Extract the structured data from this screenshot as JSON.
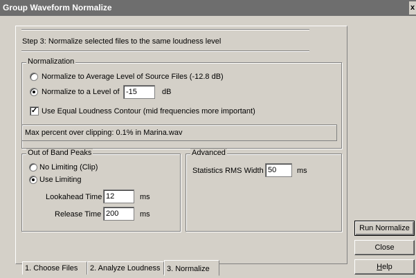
{
  "window": {
    "title": "Group Waveform Normalize",
    "close_glyph": "x"
  },
  "step_text": "Step 3:  Normalize selected files to the same loudness level",
  "normalization": {
    "legend": "Normalization",
    "option_average": "Normalize to Average Level of Source Files (-12.8 dB)",
    "option_level": "Normalize to a Level of",
    "level_value": "-15",
    "level_unit": "dB",
    "selected": "level",
    "equal_loudness_label": "Use Equal Loudness Contour (mid frequencies more important)",
    "equal_loudness_checked": true,
    "status": "Max percent over clipping: 0.1% in Marina.wav"
  },
  "out_of_band": {
    "legend": "Out of Band Peaks",
    "option_no_limiting": "No Limiting (Clip)",
    "option_use_limiting": "Use Limiting",
    "selected": "use_limiting",
    "lookahead_label": "Lookahead Time",
    "lookahead_value": "12",
    "lookahead_unit": "ms",
    "release_label": "Release Time",
    "release_value": "200",
    "release_unit": "ms"
  },
  "advanced": {
    "legend": "Advanced",
    "rms_label": "Statistics RMS Width",
    "rms_value": "50",
    "rms_unit": "ms"
  },
  "tabs": [
    {
      "label": "1. Choose Files"
    },
    {
      "label": "2. Analyze Loudness"
    },
    {
      "label": "3. Normalize"
    }
  ],
  "buttons": {
    "run": "Run Normalize",
    "close": "Close",
    "help_underlined": "H",
    "help_rest": "elp"
  }
}
